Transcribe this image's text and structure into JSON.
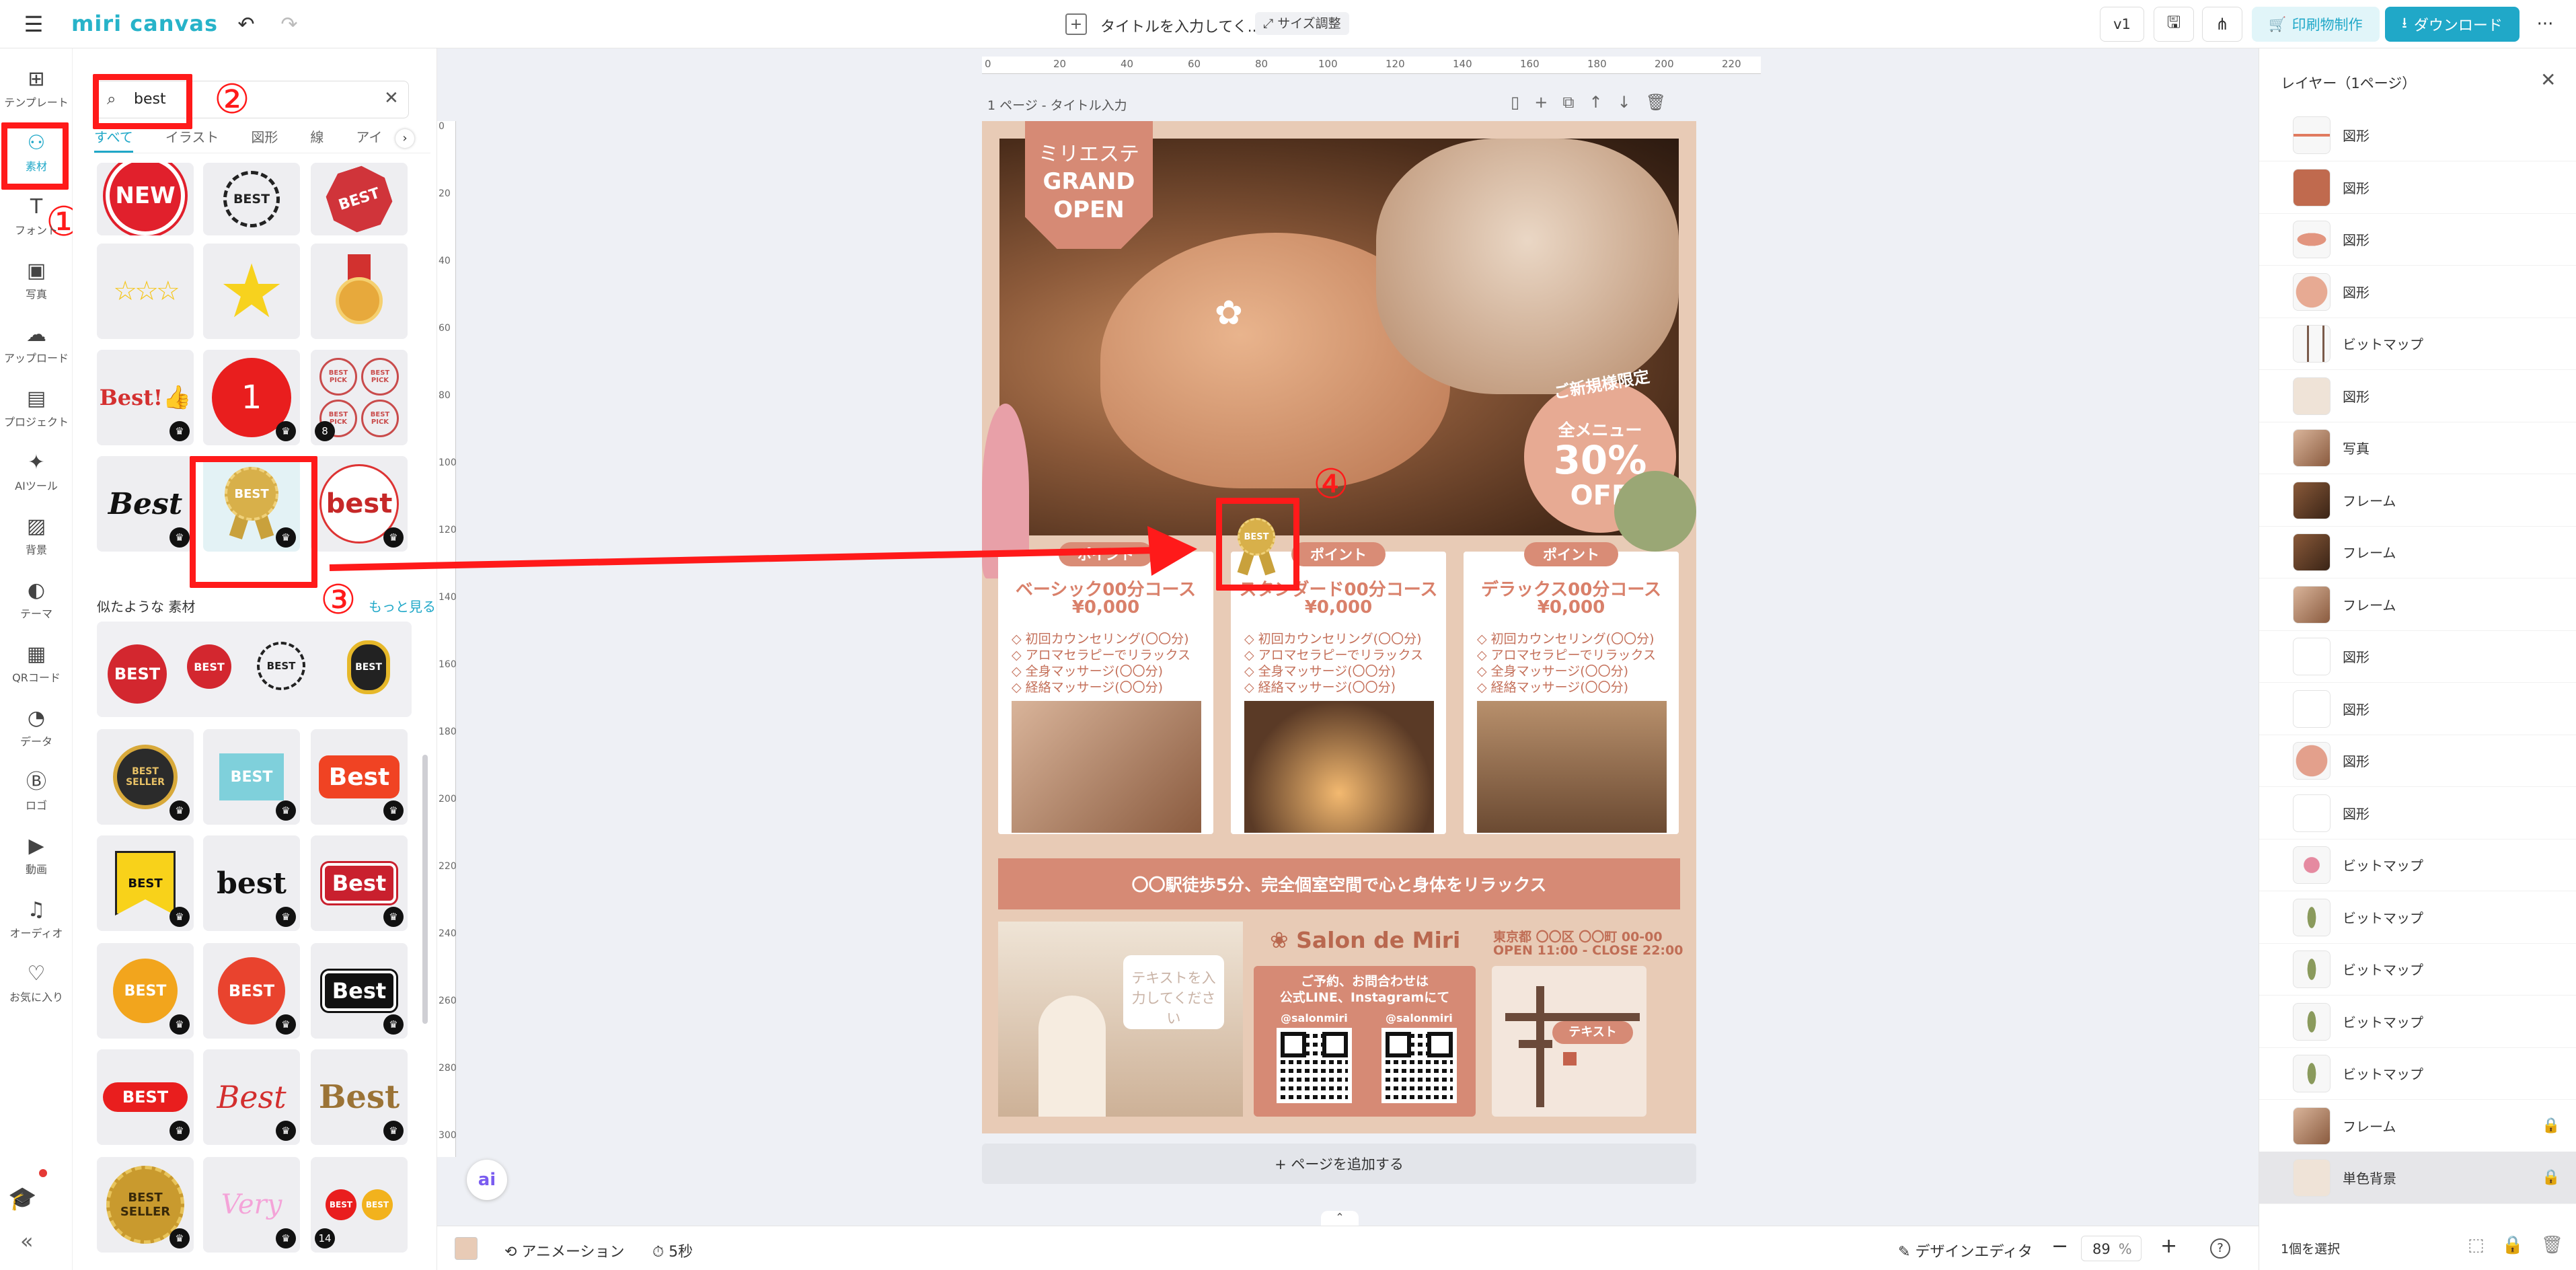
{
  "header": {
    "logo": "miri canvas",
    "doc_title": "タイトルを入力してく...",
    "resize_label": "サイズ調整",
    "version": "v1",
    "print_label": "印刷物制作",
    "download_label": "ダウンロード",
    "more": "···"
  },
  "rail": {
    "items": [
      {
        "label": "テンプレート",
        "icon": "template-icon"
      },
      {
        "label": "素材",
        "icon": "elements-icon"
      },
      {
        "label": "フォント",
        "icon": "text-icon"
      },
      {
        "label": "写真",
        "icon": "photo-icon"
      },
      {
        "label": "アップロード",
        "icon": "upload-icon"
      },
      {
        "label": "プロジェクト",
        "icon": "project-icon"
      },
      {
        "label": "AIツール",
        "icon": "ai-tool-icon"
      },
      {
        "label": "背景",
        "icon": "background-icon"
      },
      {
        "label": "テーマ",
        "icon": "theme-icon"
      },
      {
        "label": "QRコード",
        "icon": "qr-icon"
      },
      {
        "label": "データ",
        "icon": "data-icon"
      },
      {
        "label": "ロゴ",
        "icon": "logo-icon"
      },
      {
        "label": "動画",
        "icon": "video-icon"
      },
      {
        "label": "オーディオ",
        "icon": "audio-icon"
      },
      {
        "label": "お気に入り",
        "icon": "favorite-icon"
      }
    ],
    "collapse": "«"
  },
  "panel": {
    "search_value": "best",
    "tabs": [
      "すべて",
      "イラスト",
      "図形",
      "線",
      "アイ"
    ],
    "similar_title": "似たような 素材",
    "see_more": "もっと見る",
    "tile_texts": {
      "new": "NEW",
      "best": "BEST",
      "best_lower": "best",
      "best_mixed": "Best",
      "best_excl": "Best!",
      "best_pick": "BEST PICK",
      "best_seller": "BEST SELLER",
      "very": "Very",
      "one": "1"
    }
  },
  "annotations": {
    "n1": "①",
    "n2": "②",
    "n3": "③",
    "n4": "④"
  },
  "canvas": {
    "page_label": "1 ページ - タイトル入力",
    "add_page": "+ ページを追加する",
    "ruler_top": [
      "0",
      "20",
      "40",
      "60",
      "80",
      "100",
      "120",
      "140",
      "160",
      "180",
      "200",
      "220"
    ],
    "ruler_left": [
      "0",
      "20",
      "40",
      "60",
      "80",
      "100",
      "120",
      "140",
      "160",
      "180",
      "200",
      "220",
      "240",
      "260",
      "280",
      "300"
    ],
    "ai_badge": "ai"
  },
  "poster": {
    "brand_jp": "ミリエステ",
    "grand": "GRAND",
    "open": "OPEN",
    "new_customer": "ご新規様限定",
    "all_menu": "全メニュー",
    "pct": "30%",
    "off": "OFF",
    "point": "ポイント",
    "cards": [
      {
        "title": "ベーシック00分コース",
        "price": "¥0,000",
        "items": [
          "◇ 初回カウンセリング(〇〇分)",
          "◇ アロマセラピーでリラックス",
          "◇ 全身マッサージ(〇〇分)",
          "◇ 経絡マッサージ(〇〇分)"
        ]
      },
      {
        "title": "スタンダード00分コース",
        "price": "¥0,000",
        "items": [
          "◇ 初回カウンセリング(〇〇分)",
          "◇ アロマセラピーでリラックス",
          "◇ 全身マッサージ(〇〇分)",
          "◇ 経絡マッサージ(〇〇分)"
        ]
      },
      {
        "title": "デラックス00分コース",
        "price": "¥0,000",
        "items": [
          "◇ 初回カウンセリング(〇〇分)",
          "◇ アロマセラピーでリラックス",
          "◇ 全身マッサージ(〇〇分)",
          "◇ 経絡マッサージ(〇〇分)"
        ]
      }
    ],
    "banner": "〇〇駅徒歩5分、完全個室空間で心と身体をリラックス",
    "salon_name": "Salon de Miri",
    "address": "東京都 〇〇区 〇〇町 00-00",
    "hours": "OPEN 11:00 - CLOSE 22:00",
    "text_placeholder": "テキストを入力してください",
    "contact_1": "ご予約、お問合わせは",
    "contact_2": "公式LINE、Instagramにて",
    "handle_1": "@salonmiri",
    "handle_2": "@salonmiri",
    "map_text": "テキスト",
    "best_badge": "BEST"
  },
  "rightpanel": {
    "title": "レイヤー（1ページ）",
    "layers": [
      {
        "name": "図形",
        "thumb": "line"
      },
      {
        "name": "図形",
        "thumb": "rect-brown"
      },
      {
        "name": "図形",
        "thumb": "pill-salmon"
      },
      {
        "name": "図形",
        "thumb": "circle-salmon"
      },
      {
        "name": "ビットマップ",
        "thumb": "map"
      },
      {
        "name": "図形",
        "thumb": "beige"
      },
      {
        "name": "写真",
        "thumb": "photo"
      },
      {
        "name": "フレーム",
        "thumb": "photo-dark"
      },
      {
        "name": "フレーム",
        "thumb": "photo-dark"
      },
      {
        "name": "フレーム",
        "thumb": "photo"
      },
      {
        "name": "図形",
        "thumb": "white"
      },
      {
        "name": "図形",
        "thumb": "white"
      },
      {
        "name": "図形",
        "thumb": "hex-salmon"
      },
      {
        "name": "図形",
        "thumb": "white"
      },
      {
        "name": "ビットマップ",
        "thumb": "flower"
      },
      {
        "name": "ビットマップ",
        "thumb": "leaf"
      },
      {
        "name": "ビットマップ",
        "thumb": "leaf"
      },
      {
        "name": "ビットマップ",
        "thumb": "leaf"
      },
      {
        "name": "ビットマップ",
        "thumb": "leaf"
      },
      {
        "name": "フレーム",
        "thumb": "photo"
      },
      {
        "name": "単色背景",
        "thumb": "beige"
      }
    ],
    "selection": "1個を選択"
  },
  "footer": {
    "animation": "アニメーション",
    "duration": "5秒",
    "design_editor": "デザインエディタ",
    "zoom": "89",
    "zoom_unit": "%"
  },
  "colors": {
    "accent": "#20a8c8",
    "poster_bg": "#e8cbb6",
    "salmon": "#d98c76",
    "annotation_red": "#ff1a1a"
  }
}
